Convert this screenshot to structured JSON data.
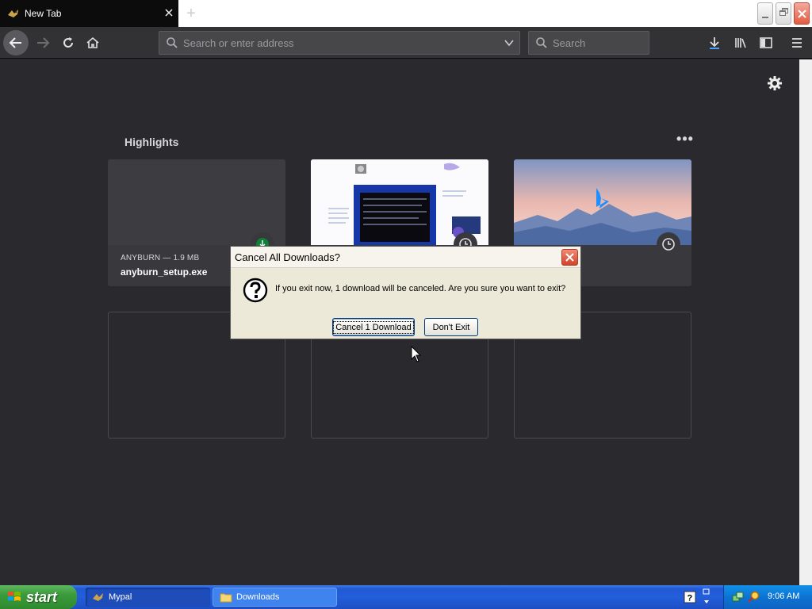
{
  "browser": {
    "tab_title": "New Tab",
    "new_tab_symbol": "+",
    "url_placeholder": "Search or enter address",
    "search_placeholder": "Search"
  },
  "content": {
    "highlights_title": "Highlights",
    "highlights_menu": "•••",
    "cards": [
      {
        "meta": "ANYBURN — 1.9 MB",
        "name": "anyburn_setup.exe",
        "badge_icon": "download-icon"
      },
      {
        "meta": "",
        "name": "",
        "badge_icon": "clock-icon"
      },
      {
        "meta": "",
        "name": "",
        "badge_icon": "clock-icon"
      }
    ]
  },
  "dialog": {
    "title": "Cancel All Downloads?",
    "message": "If you exit now, 1 download will be canceled. Are you sure you want to exit?",
    "cancel_button": "Cancel 1 Download",
    "dont_exit_button": "Don't Exit",
    "icon": "question-icon"
  },
  "taskbar": {
    "start_label": "start",
    "tasks": [
      {
        "label": "Mypal",
        "active": true
      },
      {
        "label": "Downloads",
        "active": false
      }
    ],
    "clock": "9:06 AM"
  },
  "colors": {
    "page_bg": "#2a2a2e",
    "card_bg": "#38383d",
    "toolbar_bg": "#323234",
    "taskbar_blue": "#245edb",
    "start_green": "#3b9a3b",
    "bing_blue": "#0a84ff"
  }
}
